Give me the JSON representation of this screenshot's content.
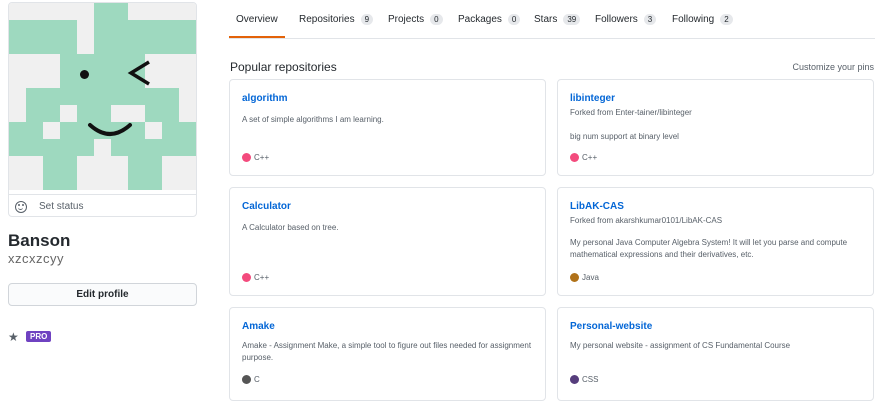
{
  "profile": {
    "status_label": "Set status",
    "name": "Banson",
    "login": "xzcxzcyy",
    "edit_button": "Edit profile",
    "pro_badge": "PRO"
  },
  "tabs": [
    {
      "label": "Overview",
      "count": null
    },
    {
      "label": "Repositories",
      "count": "9"
    },
    {
      "label": "Projects",
      "count": "0"
    },
    {
      "label": "Packages",
      "count": "0"
    },
    {
      "label": "Stars",
      "count": "39"
    },
    {
      "label": "Followers",
      "count": "3"
    },
    {
      "label": "Following",
      "count": "2"
    }
  ],
  "active_tab": "Overview",
  "popular": {
    "title": "Popular repositories",
    "customize": "Customize your pins"
  },
  "repos": [
    {
      "name": "algorithm",
      "fork": "",
      "description": "A set of simple algorithms I am learning.",
      "language": "C++",
      "lang_color": "#f34b7d"
    },
    {
      "name": "libinteger",
      "fork": "Forked from Enter-tainer/libinteger",
      "description": "big num support at binary level",
      "language": "C++",
      "lang_color": "#f34b7d"
    },
    {
      "name": "Calculator",
      "fork": "",
      "description": "A Calculator based on tree.",
      "language": "C++",
      "lang_color": "#f34b7d"
    },
    {
      "name": "LibAK-CAS",
      "fork": "Forked from akarshkumar0101/LibAK-CAS",
      "description": "My personal Java Computer Algebra System! It will let you parse and compute mathematical expressions and their derivatives, etc.",
      "language": "Java",
      "lang_color": "#b07219"
    },
    {
      "name": "Amake",
      "fork": "",
      "description": "Amake - Assignment Make, a simple tool to figure out files needed for assignment purpose.",
      "language": "C",
      "lang_color": "#555555"
    },
    {
      "name": "Personal-website",
      "fork": "",
      "description": "My personal website - assignment of CS Fundamental Course",
      "language": "CSS",
      "lang_color": "#563d7c"
    }
  ],
  "colors": {
    "accent_tab": "#e36209",
    "link": "#0366d6",
    "avatar_green": "#9ed9bf",
    "pro_purple": "#6f42c1"
  }
}
